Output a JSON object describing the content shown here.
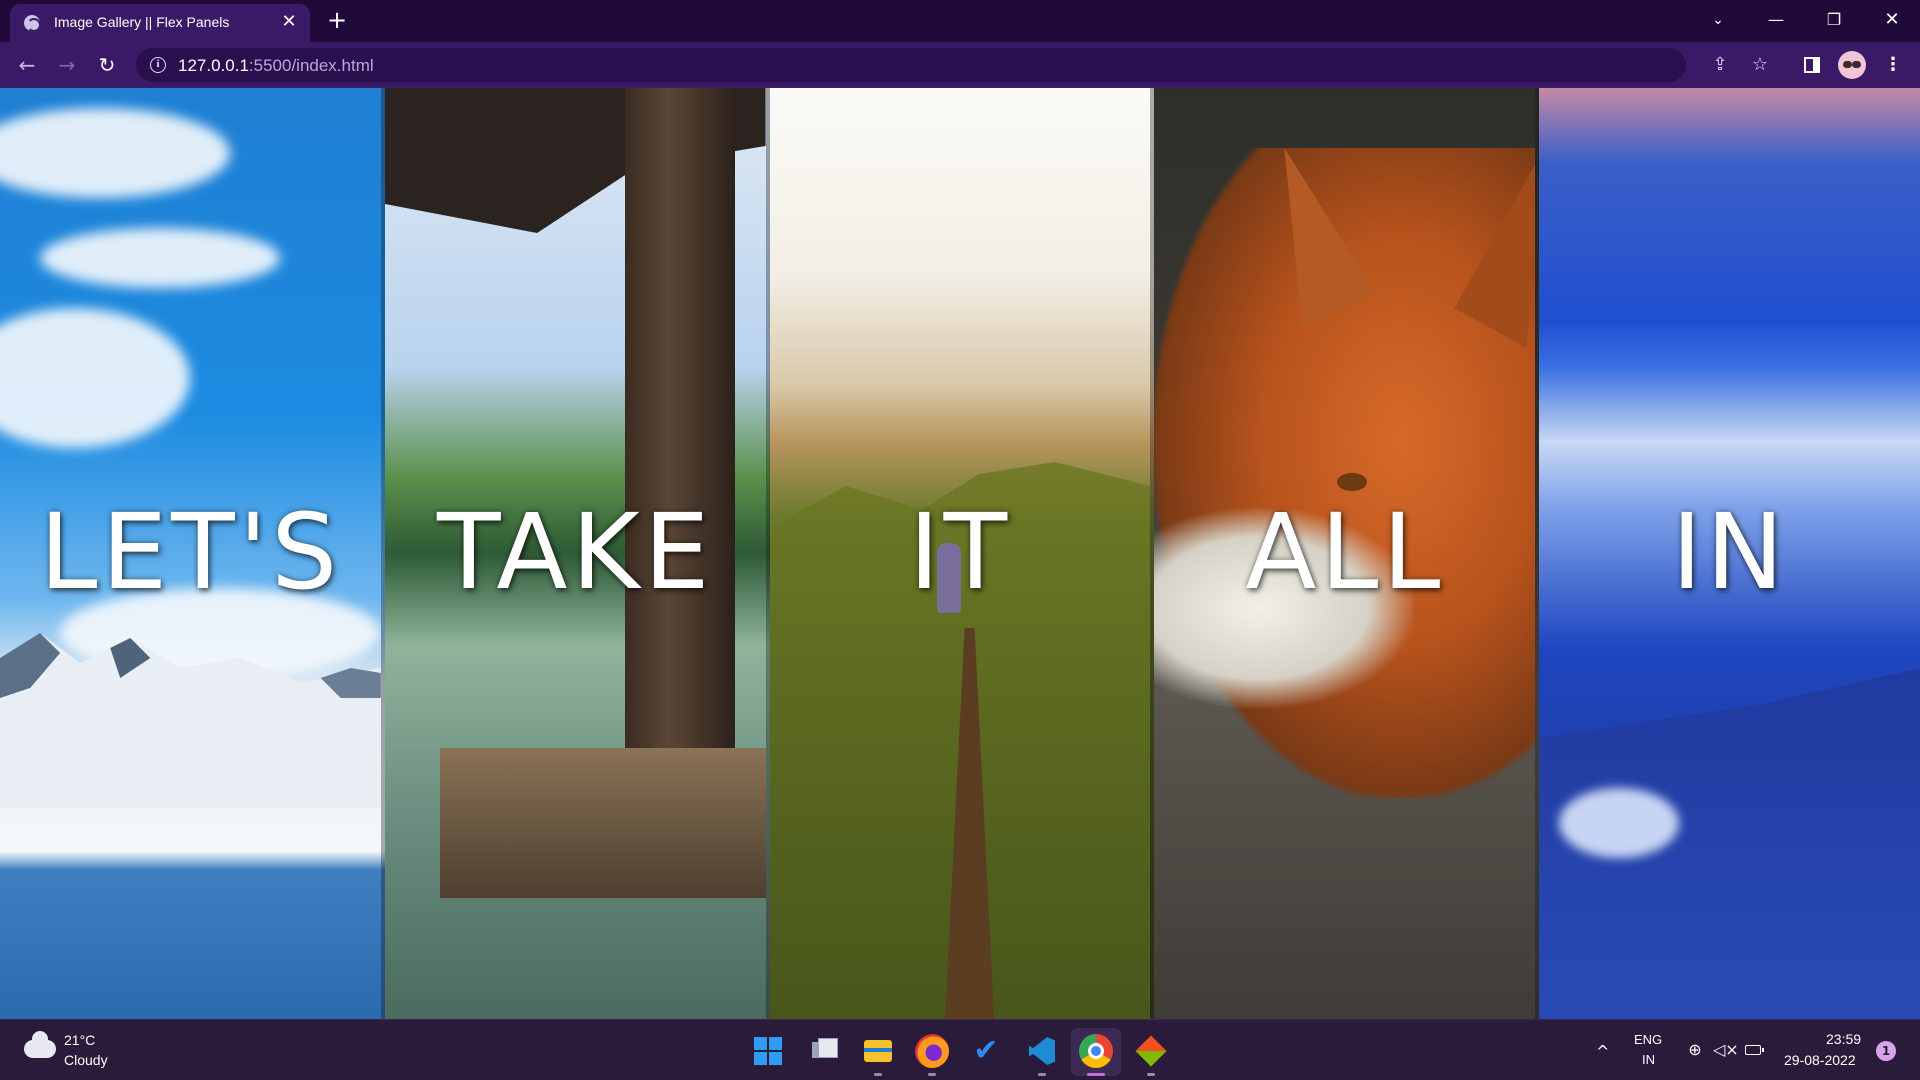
{
  "browser": {
    "tab_title": "Image Gallery || Flex Panels",
    "tab_close": "✕",
    "new_tab": "+",
    "url_host": "127.0.0.1",
    "url_rest": ":5500/index.html",
    "window_controls": {
      "tab_search": "⌄",
      "minimize": "—",
      "restore": "❐",
      "close": "✕"
    },
    "nav": {
      "back": "←",
      "forward": "→",
      "reload": "↻"
    },
    "icons": {
      "share": "⇪",
      "bookmark": "☆",
      "menu": "⋮"
    }
  },
  "panels": [
    {
      "word": "LET'S",
      "theme": "sky-mountain-lake"
    },
    {
      "word": "TAKE",
      "theme": "wooden-dock-lake"
    },
    {
      "word": "IT",
      "theme": "mountain-trail-hiker"
    },
    {
      "word": "ALL",
      "theme": "red-fox"
    },
    {
      "word": "IN",
      "theme": "blue-clouds-landscape"
    }
  ],
  "taskbar": {
    "weather": {
      "temp": "21°C",
      "desc": "Cloudy",
      "icon": "cloud-icon"
    },
    "apps": [
      "start",
      "task-view",
      "file-explorer",
      "firefox",
      "microsoft-todo",
      "vscode",
      "chrome",
      "gitkraken"
    ],
    "tray": {
      "chevron": "^",
      "lang_top": "ENG",
      "lang_bottom": "IN",
      "network": "⊕",
      "volume": "🔇",
      "time": "23:59",
      "date": "29-08-2022",
      "notifications": "1"
    }
  },
  "colors": {
    "titlebar": "#1f0a3a",
    "toolbar": "#3a1a66",
    "taskbar": "#2a1b3a",
    "accent": "#c86fd6"
  }
}
